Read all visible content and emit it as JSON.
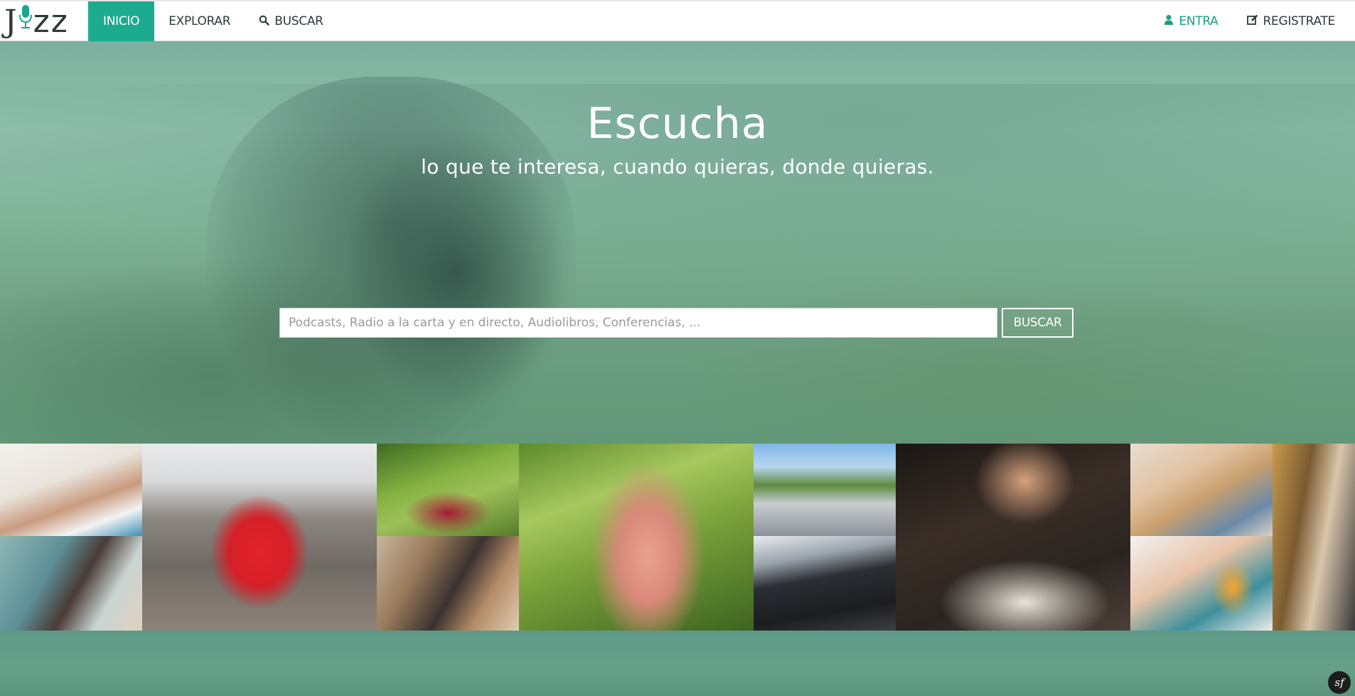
{
  "brand": {
    "logo_text_j": "J",
    "logo_text_zz": "zz",
    "accent": "#1dab8f"
  },
  "nav": {
    "left": [
      {
        "label": "INICIO",
        "active": true
      },
      {
        "label": "EXPLORAR",
        "active": false
      },
      {
        "label": "BUSCAR",
        "icon": "search-icon",
        "active": false
      }
    ],
    "right": [
      {
        "label": "ENTRA",
        "icon": "user-icon"
      },
      {
        "label": "REGISTRATE",
        "icon": "edit-icon"
      }
    ]
  },
  "hero": {
    "title": "Escucha",
    "subtitle": "lo que te interesa, cuando quieras, donde quieras.",
    "search": {
      "placeholder": "Podcasts, Radio a la carta y en directo, Audiolibros, Conferencias, ...",
      "value": "",
      "button_label": "BUSCAR"
    }
  },
  "mosaic": {
    "tiles": [
      {
        "name": "photo-woman-headphones-studying"
      },
      {
        "name": "photo-woman-on-train"
      },
      {
        "name": "photo-man-running"
      },
      {
        "name": "photo-woman-in-grass"
      },
      {
        "name": "photo-man-with-phone"
      },
      {
        "name": "photo-woman-headphones-park"
      },
      {
        "name": "photo-group-outdoors-laptop"
      },
      {
        "name": "photo-driving-car"
      },
      {
        "name": "photo-boy-studying-lamp"
      },
      {
        "name": "photo-two-girls-phone"
      },
      {
        "name": "photo-woman-juice-earbuds"
      },
      {
        "name": "photo-man-with-phone-city"
      }
    ]
  },
  "footer": {
    "badge_text": "sf"
  }
}
